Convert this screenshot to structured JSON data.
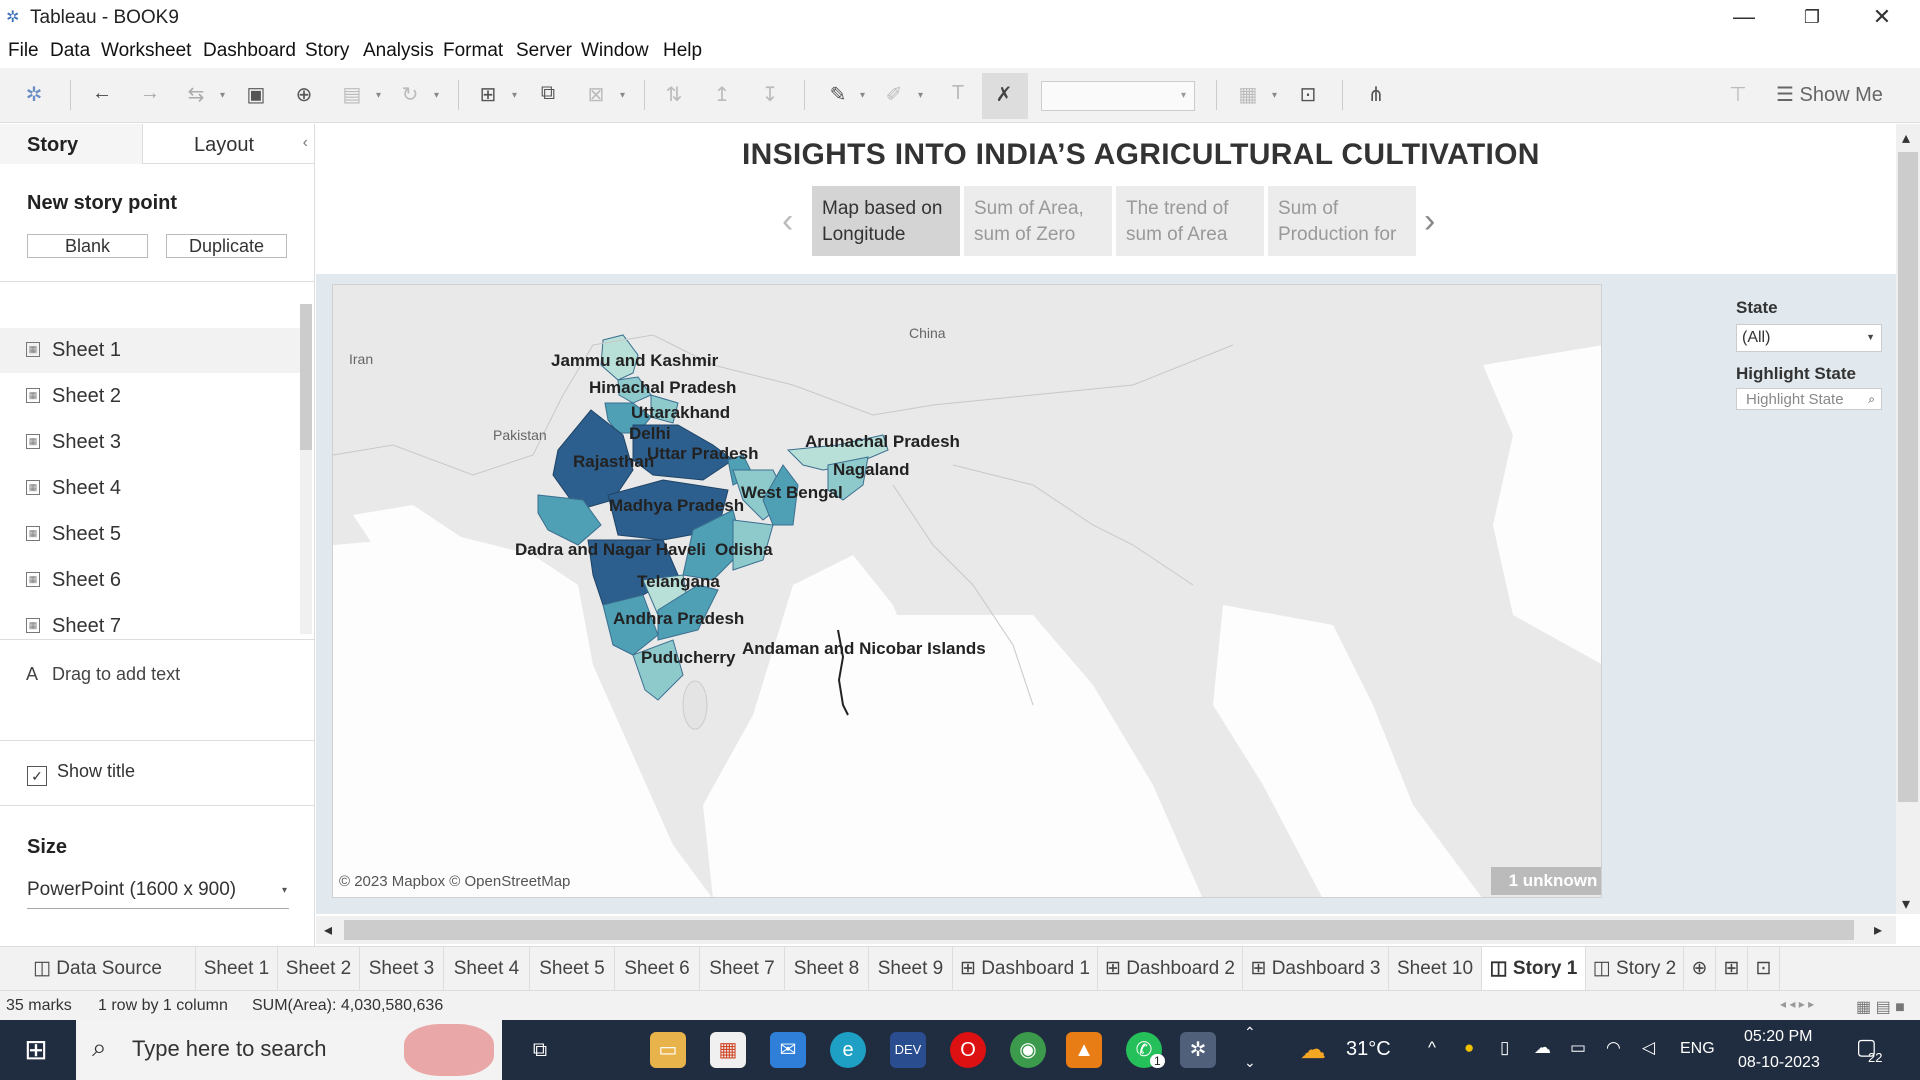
{
  "window": {
    "title": "Tableau - BOOK9"
  },
  "menu": [
    "File",
    "Data",
    "Worksheet",
    "Dashboard",
    "Story",
    "Analysis",
    "Format",
    "Server",
    "Window",
    "Help"
  ],
  "toolbar": {
    "show_me": "Show Me"
  },
  "left_pane": {
    "tabs": {
      "story": "Story",
      "layout": "Layout"
    },
    "new_story_point": "New story point",
    "blank": "Blank",
    "duplicate": "Duplicate",
    "sheets": [
      "Sheet 1",
      "Sheet 2",
      "Sheet 3",
      "Sheet 4",
      "Sheet 5",
      "Sheet 6",
      "Sheet 7"
    ],
    "drag_text": "Drag to add text",
    "drag_icon_letter": "A",
    "show_title": "Show title",
    "size_label": "Size",
    "size_value": "PowerPoint (1600 x 900)"
  },
  "story": {
    "title": "INSIGHTS INTO INDIA’S AGRICULTURAL CULTIVATION",
    "points": [
      {
        "line1": "Map based on",
        "line2": "Longitude"
      },
      {
        "line1": "Sum of Area,",
        "line2": "sum of Zero"
      },
      {
        "line1": "The trend of",
        "line2": "sum of Area"
      },
      {
        "line1": "Sum of",
        "line2": "Production for"
      }
    ]
  },
  "map": {
    "countries": [
      "Iran",
      "Pakistan",
      "China"
    ],
    "state_labels": [
      "Jammu and Kashmir",
      "Himachal Pradesh",
      "Uttarakhand",
      "Delhi",
      "Rajasthan",
      "Uttar Pradesh",
      "Arunachal Pradesh",
      "Nagaland",
      "West Bengal",
      "Madhya Pradesh",
      "Dadra and Nagar Haveli",
      "Odisha",
      "Telangana",
      "Andhra Pradesh",
      "Puducherry",
      "Andaman and Nicobar Islands"
    ],
    "copyright": "© 2023 Mapbox © OpenStreetMap",
    "unknown_badge": "1 unknown",
    "colors": {
      "dark": "#2d5f8e",
      "mid": "#4f9fb5",
      "light": "#8ec9cc",
      "pale": "#b9e0d8"
    }
  },
  "filters": {
    "state_label": "State",
    "state_value": "(All)",
    "highlight_label": "Highlight State",
    "highlight_placeholder": "Highlight State"
  },
  "bottom_tabs": [
    "Data Source",
    "Sheet 1",
    "Sheet 2",
    "Sheet 3",
    "Sheet 4",
    "Sheet 5",
    "Sheet 6",
    "Sheet 7",
    "Sheet 8",
    "Sheet 9",
    "Dashboard 1",
    "Dashboard 2",
    "Dashboard 3",
    "Sheet 10",
    "Story 1",
    "Story 2"
  ],
  "status": {
    "marks": "35 marks",
    "rows": "1 row by 1 column",
    "sum": "SUM(Area): 4,030,580,636"
  },
  "taskbar": {
    "search_placeholder": "Type here to search",
    "weather": "31°C",
    "lang": "ENG",
    "time": "05:20 PM",
    "date": "08-10-2023",
    "notifications": "22",
    "whatsapp_badge": "1"
  }
}
